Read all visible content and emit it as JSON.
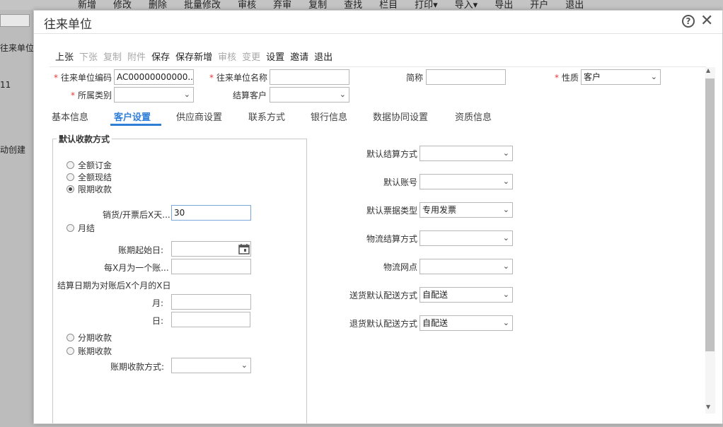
{
  "background": {
    "toolbar_items": [
      "新增",
      "修改",
      "删除",
      "批量修改",
      "审核",
      "弃审",
      "复制",
      "查找",
      "栏目",
      "打印▾",
      "导入▾",
      "导出",
      "开户",
      "退出"
    ],
    "left_texts": [
      "往来单位",
      "11",
      "动创建"
    ]
  },
  "dialog": {
    "title": "往来单位",
    "help_symbol": "?",
    "close_symbol": "✕"
  },
  "actions": [
    {
      "label": "上张",
      "enabled": true
    },
    {
      "label": "下张",
      "enabled": false
    },
    {
      "label": "复制",
      "enabled": false
    },
    {
      "label": "附件",
      "enabled": false
    },
    {
      "label": "保存",
      "enabled": true
    },
    {
      "label": "保存新增",
      "enabled": true
    },
    {
      "label": "审核",
      "enabled": false
    },
    {
      "label": "变更",
      "enabled": false
    },
    {
      "label": "设置",
      "enabled": true
    },
    {
      "label": "邀请",
      "enabled": true
    },
    {
      "label": "退出",
      "enabled": true
    }
  ],
  "header_fields": {
    "code_label": "往来单位编码",
    "code_value": "AC00000000000...",
    "name_label": "往来单位名称",
    "name_value": "",
    "short_label": "简称",
    "short_value": "",
    "nature_label": "性质",
    "nature_value": "客户",
    "category_label": "所属类别",
    "category_value": "",
    "settle_customer_label": "结算客户",
    "settle_customer_value": ""
  },
  "required_mark": "*",
  "tabs": [
    "基本信息",
    "客户设置",
    "供应商设置",
    "联系方式",
    "银行信息",
    "数据协同设置",
    "资质信息"
  ],
  "active_tab": "客户设置",
  "collection": {
    "group_title": "默认收款方式",
    "radios": {
      "full_deposit": "全额订金",
      "full_cash": "全额现结",
      "limited": "限期收款",
      "monthly": "月结",
      "installment": "分期收款",
      "credit": "账期收款"
    },
    "selected": "限期收款",
    "days_label": "销货/开票后X天...",
    "days_value": "30",
    "period_start_label": "账期起始日:",
    "period_start_value": "",
    "every_x_month_label": "每X月为一个账...",
    "every_x_month_value": "",
    "settle_date_label": "结算日期为对账后X个月的X日",
    "month_label": "月:",
    "month_value": "",
    "day_label": "日:",
    "day_value": "",
    "credit_method_label": "账期收款方式:",
    "credit_method_value": ""
  },
  "right_fields": [
    {
      "label": "默认结算方式",
      "value": ""
    },
    {
      "label": "默认账号",
      "value": ""
    },
    {
      "label": "默认票据类型",
      "value": "专用发票"
    },
    {
      "label": "物流结算方式",
      "value": ""
    },
    {
      "label": "物流网点",
      "value": ""
    },
    {
      "label": "送货默认配送方式",
      "value": "自配送"
    },
    {
      "label": "退货默认配送方式",
      "value": "自配送"
    }
  ],
  "chevron": "⌄",
  "scroll_up": "▲",
  "scroll_down": "▼"
}
